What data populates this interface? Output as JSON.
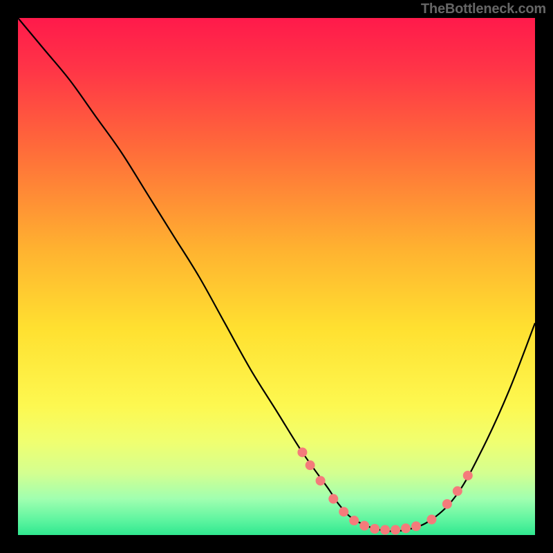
{
  "watermark": "TheBottleneck.com",
  "chart_data": {
    "type": "line",
    "title": "",
    "xlabel": "",
    "ylabel": "",
    "xlim": [
      0,
      100
    ],
    "ylim": [
      0,
      100
    ],
    "background_gradient": {
      "stops": [
        {
          "offset": 0.0,
          "color": "#ff1a4b"
        },
        {
          "offset": 0.1,
          "color": "#ff3547"
        },
        {
          "offset": 0.25,
          "color": "#ff6a3a"
        },
        {
          "offset": 0.45,
          "color": "#ffb330"
        },
        {
          "offset": 0.6,
          "color": "#ffe030"
        },
        {
          "offset": 0.75,
          "color": "#fdf850"
        },
        {
          "offset": 0.82,
          "color": "#f0ff70"
        },
        {
          "offset": 0.88,
          "color": "#d4ff90"
        },
        {
          "offset": 0.93,
          "color": "#a0ffb0"
        },
        {
          "offset": 0.97,
          "color": "#60f5a0"
        },
        {
          "offset": 1.0,
          "color": "#30e890"
        }
      ]
    },
    "series": [
      {
        "name": "bottleneck-curve",
        "x": [
          0,
          5,
          10,
          15,
          20,
          25,
          30,
          35,
          40,
          45,
          50,
          55,
          60,
          62,
          65,
          70,
          75,
          80,
          85,
          90,
          95,
          100
        ],
        "y": [
          100,
          94,
          88,
          81,
          74,
          66,
          58,
          50,
          41,
          32,
          24,
          16,
          9,
          6,
          3,
          1,
          1,
          3,
          8,
          17,
          28,
          41
        ]
      }
    ],
    "markers": {
      "name": "highlight-points",
      "color": "#f47b7b",
      "radius": 7,
      "points": [
        {
          "x": 55.0,
          "y": 16.0
        },
        {
          "x": 56.5,
          "y": 13.5
        },
        {
          "x": 58.5,
          "y": 10.5
        },
        {
          "x": 61.0,
          "y": 7.0
        },
        {
          "x": 63.0,
          "y": 4.5
        },
        {
          "x": 65.0,
          "y": 2.8
        },
        {
          "x": 67.0,
          "y": 1.8
        },
        {
          "x": 69.0,
          "y": 1.2
        },
        {
          "x": 71.0,
          "y": 1.0
        },
        {
          "x": 73.0,
          "y": 1.0
        },
        {
          "x": 75.0,
          "y": 1.3
        },
        {
          "x": 77.0,
          "y": 1.7
        },
        {
          "x": 80.0,
          "y": 3.0
        },
        {
          "x": 83.0,
          "y": 6.0
        },
        {
          "x": 85.0,
          "y": 8.5
        },
        {
          "x": 87.0,
          "y": 11.5
        }
      ]
    }
  }
}
